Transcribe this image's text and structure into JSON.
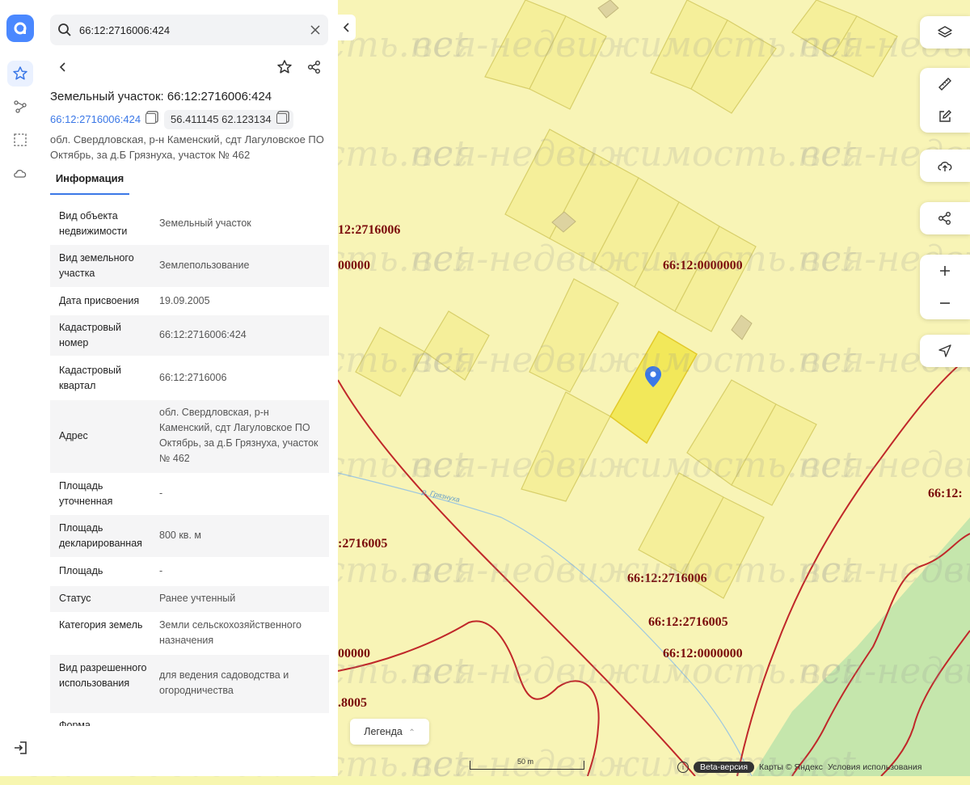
{
  "search": {
    "value": "66:12:2716006:424"
  },
  "object": {
    "title": "Земельный участок: 66:12:2716006:424",
    "cad_number": "66:12:2716006:424",
    "coords": "56.411145 62.123134",
    "address": "обл. Свердловская, р-н Каменский, сдт Лагуловское ПО Октябрь, за д.Б Грязнуха, участок № 462"
  },
  "tabs": {
    "info": "Информация"
  },
  "attributes": [
    {
      "key": "Вид объекта недвижимости",
      "value": "Земельный участок"
    },
    {
      "key": "Вид земельного участка",
      "value": "Землепользование"
    },
    {
      "key": "Дата присвоения",
      "value": "19.09.2005"
    },
    {
      "key": "Кадастровый номер",
      "value": "66:12:2716006:424"
    },
    {
      "key": "Кадастровый квартал",
      "value": "66:12:2716006"
    },
    {
      "key": "Адрес",
      "value": "обл. Свердловская, р-н Каменский, сдт Лагуловское ПО Октябрь, за д.Б Грязнуха, участок № 462"
    },
    {
      "key": "Площадь уточненная",
      "value": "-"
    },
    {
      "key": "Площадь декларированная",
      "value": "800 кв. м"
    },
    {
      "key": "Площадь",
      "value": "-"
    },
    {
      "key": "Статус",
      "value": "Ранее учтенный"
    },
    {
      "key": "Категория земель",
      "value": "Земли сельскохозяйственного назначения"
    },
    {
      "key": "Вид разрешенного использования",
      "value": "для ведения садоводства и огородничества"
    },
    {
      "key": "Форма",
      "value": ""
    }
  ],
  "map_labels": {
    "l1": "12:2716006",
    "l2": "00000",
    "l3": "66:12:0000000",
    "l4": ":2716005",
    "l5": "66:12:2716006",
    "l6": "66:12:2716005",
    "l7": "66:12:0000000",
    "l8": "00000",
    "l9": ".8005",
    "l10": "66:12:"
  },
  "river": "р. Грязнуха",
  "legend": "Легенда",
  "scale": "50 m",
  "attribution": {
    "beta": "Beta-версия",
    "maps": "Карты © Яндекс",
    "terms": "Условия использования"
  },
  "watermark": "вся-недвижимость.net",
  "colors": {
    "accent": "#3b78e7",
    "selected_parcel": "#f5ef6a",
    "boundary": "#c0282a"
  }
}
